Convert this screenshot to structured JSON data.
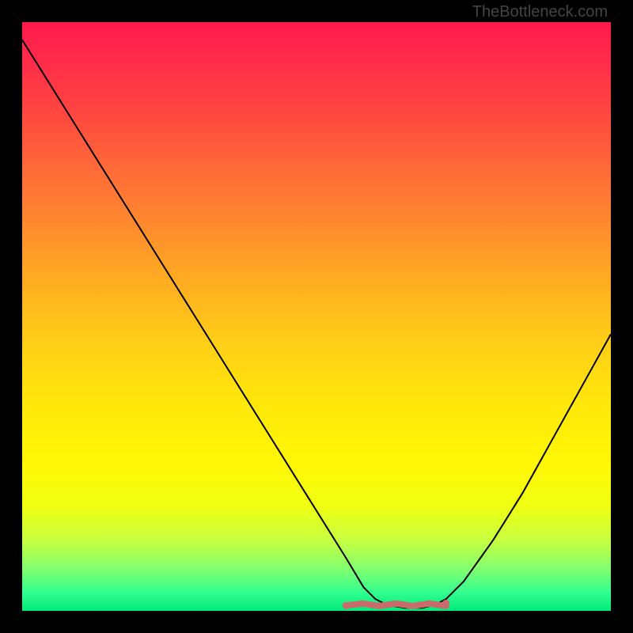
{
  "watermark": "TheBottleneck.com",
  "chart_data": {
    "type": "line",
    "title": "",
    "xlabel": "",
    "ylabel": "",
    "xlim": [
      0,
      100
    ],
    "ylim": [
      0,
      100
    ],
    "grid": false,
    "background": "red-orange-yellow-green vertical gradient",
    "series": [
      {
        "name": "curve",
        "color": "#000000",
        "x": [
          0,
          5,
          10,
          15,
          20,
          25,
          30,
          35,
          40,
          45,
          50,
          55,
          58,
          60,
          62,
          65,
          68,
          70,
          72,
          75,
          80,
          85,
          90,
          95,
          100
        ],
        "y": [
          97,
          89,
          81,
          73,
          65,
          57,
          49,
          41,
          33,
          25,
          17,
          9,
          4,
          2,
          1,
          0.5,
          0.5,
          1,
          2,
          5,
          12,
          20,
          29,
          38,
          47
        ]
      }
    ],
    "annotations": [
      {
        "type": "marker-strip",
        "color": "#cc6666",
        "x_range": [
          55,
          72
        ],
        "y": 0.5,
        "description": "short red segment near curve minimum"
      }
    ]
  }
}
